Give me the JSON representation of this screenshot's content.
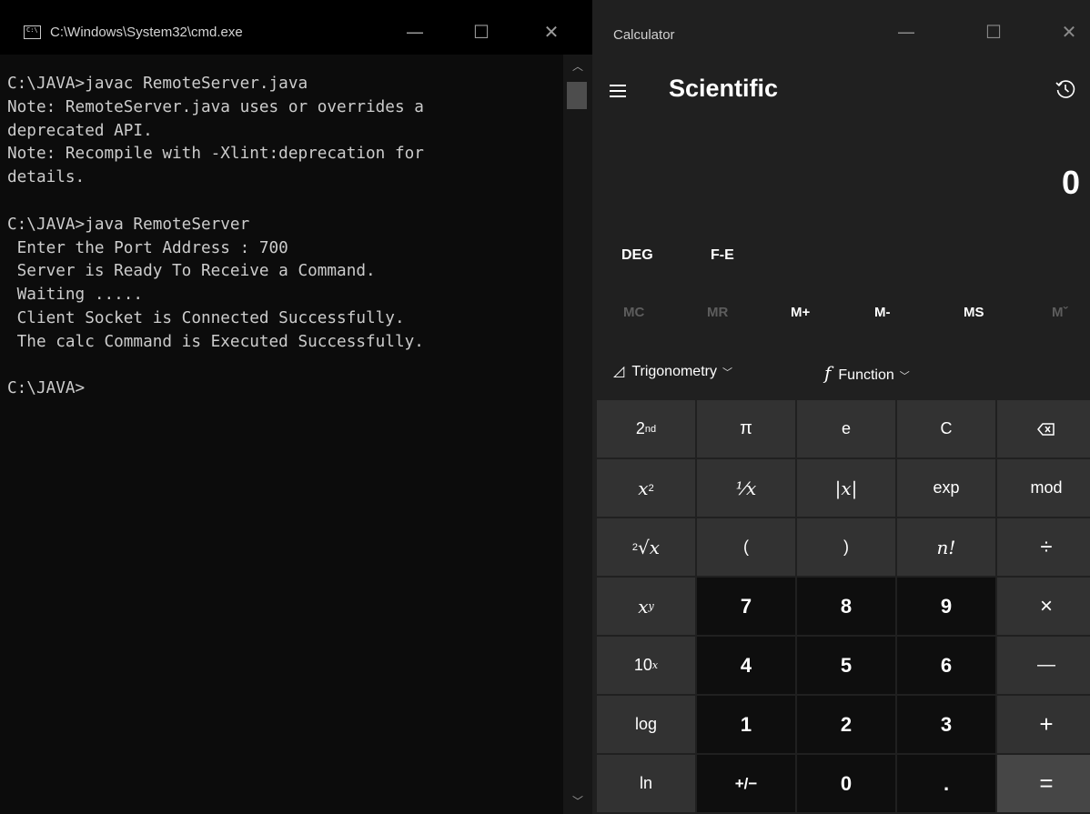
{
  "cmd": {
    "title": "C:\\Windows\\System32\\cmd.exe",
    "icon": "console-icon",
    "controls": {
      "minimize": "—",
      "maximize": "☐",
      "close": "✕"
    },
    "output": "C:\\JAVA>javac RemoteServer.java\nNote: RemoteServer.java uses or overrides a\ndeprecated API.\nNote: Recompile with -Xlint:deprecation for\ndetails.\n\nC:\\JAVA>java RemoteServer\n Enter the Port Address : 700\n Server is Ready To Receive a Command.\n Waiting .....\n Client Socket is Connected Successfully.\n The calc Command is Executed Successfully.\n\nC:\\JAVA>"
  },
  "calculator": {
    "title": "Calculator",
    "controls": {
      "minimize": "—",
      "maximize": "☐",
      "close": "✕"
    },
    "mode": "Scientific",
    "display": "0",
    "angle_mode": "DEG",
    "notation": "F-E",
    "memory": [
      "MC",
      "MR",
      "M+",
      "M-",
      "MS",
      "Mˇ"
    ],
    "trig_label": "Trigonometry",
    "func_label": "Function",
    "keys": {
      "second": "2",
      "second_sup": "nd",
      "pi": "π",
      "e": "e",
      "clear": "C",
      "x": "x",
      "sq_sup": "2",
      "reciprocal": "⅟x",
      "abs": "|x|",
      "exp": "exp",
      "mod": "mod",
      "root_sup": "2",
      "root": "√x",
      "lparen": "(",
      "rparen": ")",
      "factorial": "n!",
      "divide": "÷",
      "pow_sup": "y",
      "seven": "7",
      "eight": "8",
      "nine": "9",
      "multiply": "×",
      "ten": "10",
      "ten_sup": "x",
      "four": "4",
      "five": "5",
      "six": "6",
      "minus": "—",
      "log": "log",
      "one": "1",
      "two": "2",
      "three": "3",
      "plus": "+",
      "ln": "ln",
      "negate": "+/−",
      "zero": "0",
      "decimal": ".",
      "equals": "="
    }
  }
}
